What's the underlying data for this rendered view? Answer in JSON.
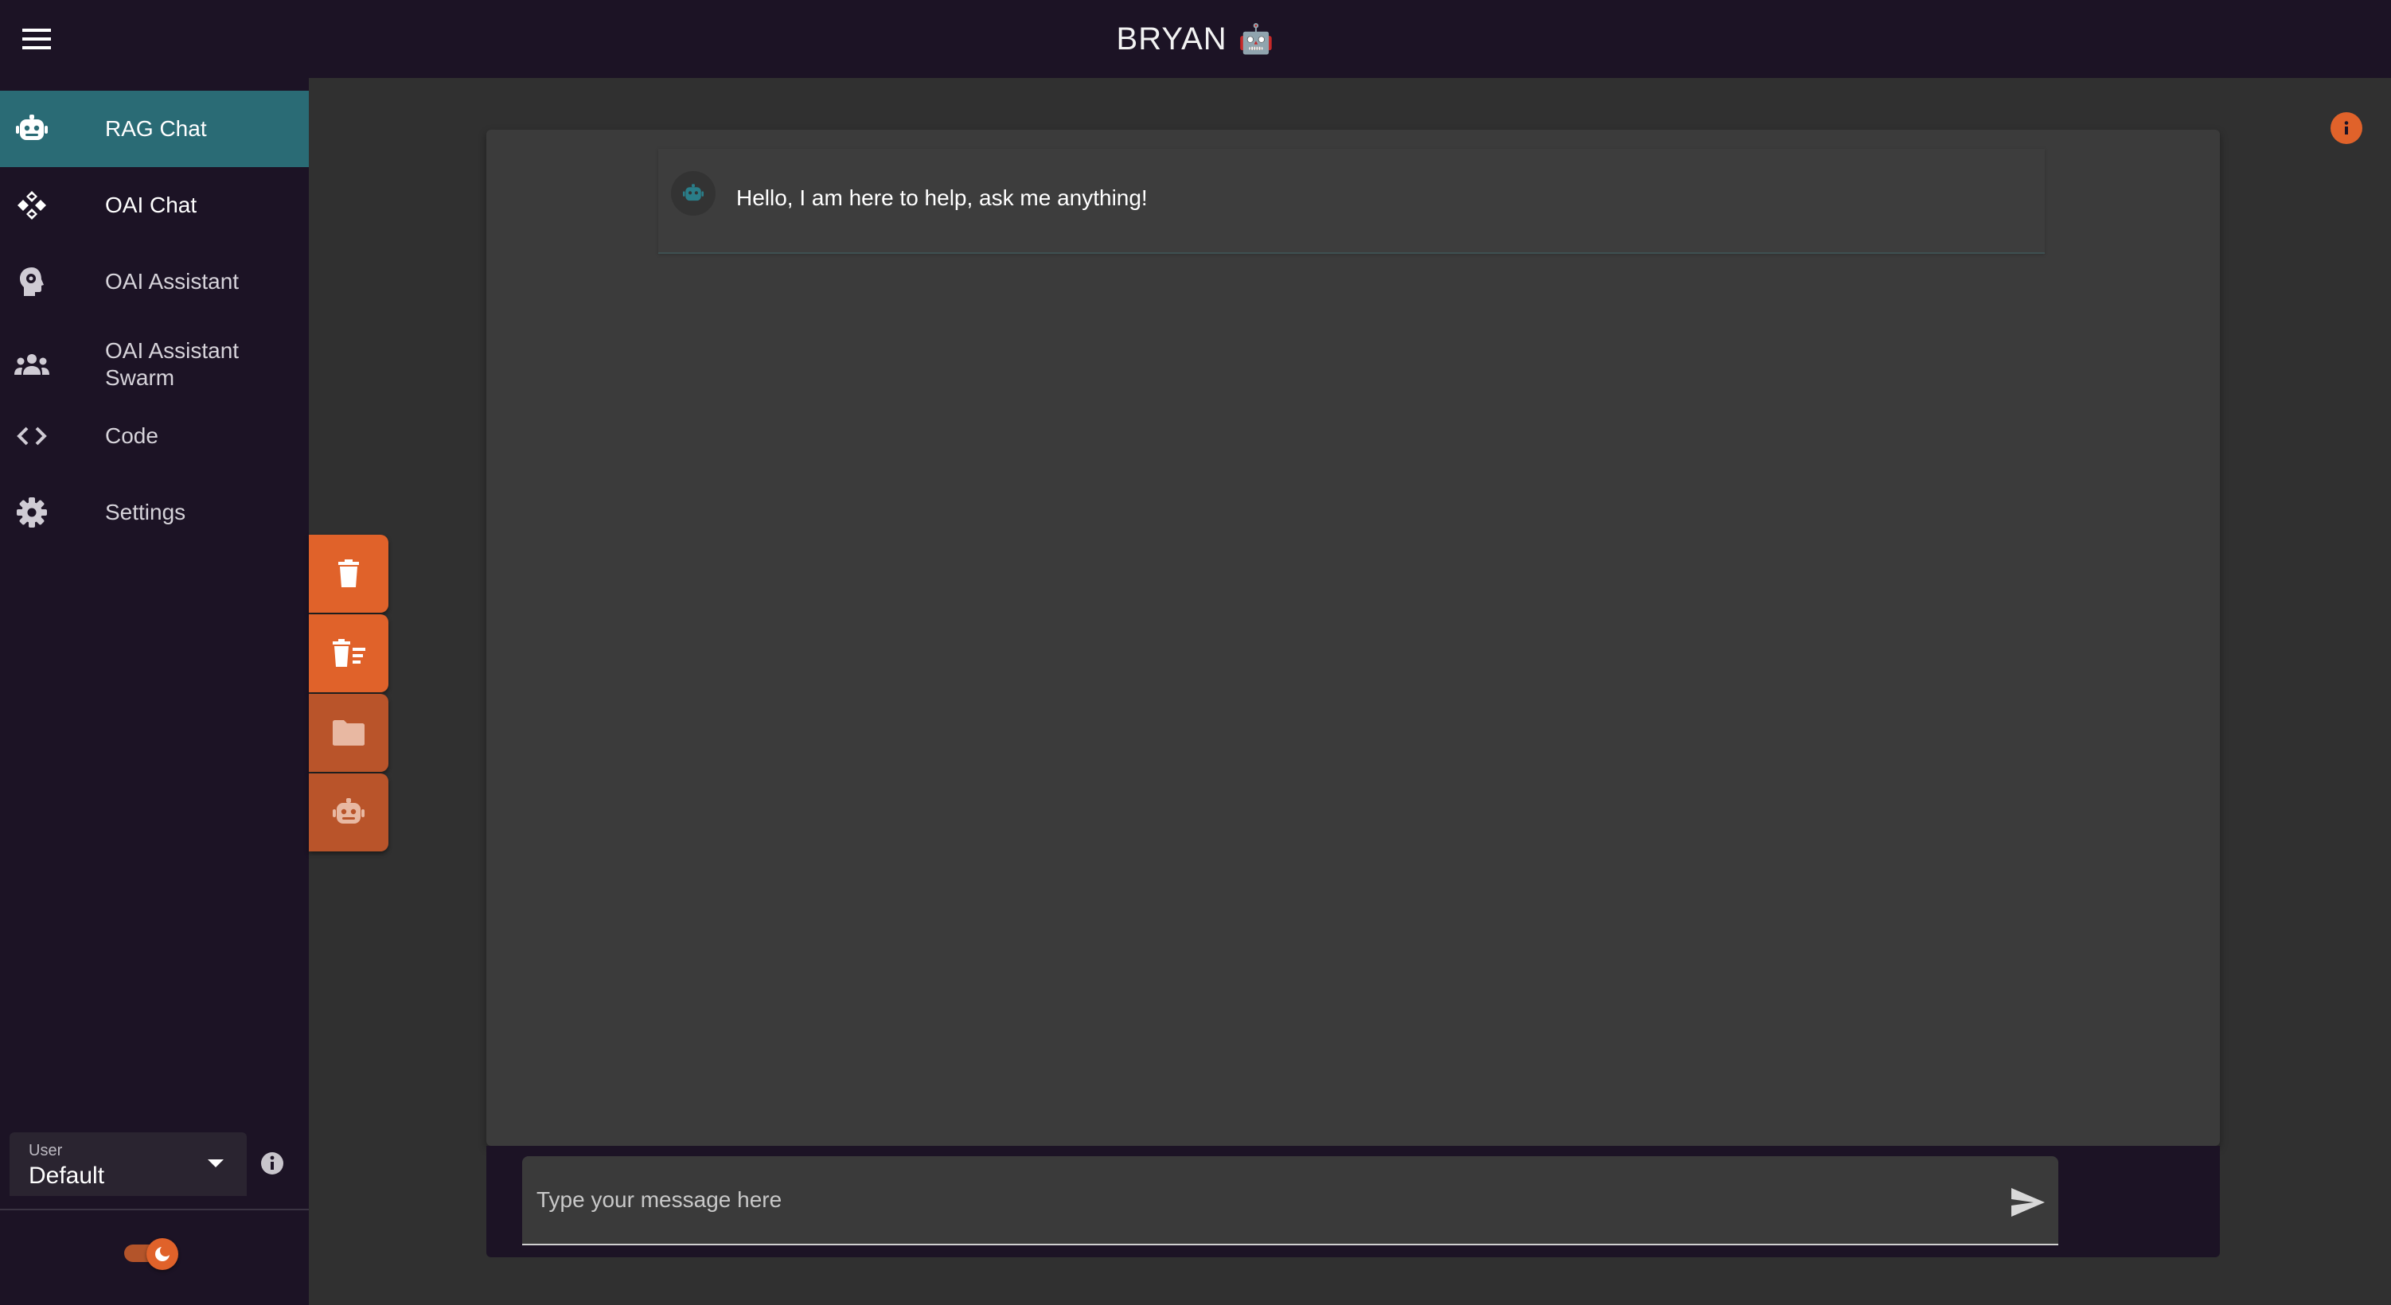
{
  "header": {
    "title": "BRYAN",
    "title_emoji": "🤖",
    "menu_icon": "hamburger-menu-icon"
  },
  "sidebar": {
    "items": [
      {
        "label": "RAG Chat",
        "icon": "robot-icon",
        "active": true
      },
      {
        "label": "OAI Chat",
        "icon": "openai-icon",
        "active": false
      },
      {
        "label": "OAI Assistant",
        "icon": "head-gear-icon",
        "active": false
      },
      {
        "label": "OAI Assistant Swarm",
        "icon": "group-icon",
        "active": false
      },
      {
        "label": "Code",
        "icon": "code-icon",
        "active": false
      },
      {
        "label": "Settings",
        "icon": "gear-icon",
        "active": false
      }
    ],
    "user_select": {
      "label": "User",
      "value": "Default"
    },
    "theme_toggle": {
      "dark_mode": true
    }
  },
  "actions": [
    {
      "name": "delete-chat-button",
      "icon": "trash-icon"
    },
    {
      "name": "delete-history-button",
      "icon": "trash-list-icon"
    },
    {
      "name": "open-folder-button",
      "icon": "folder-icon"
    },
    {
      "name": "bot-settings-button",
      "icon": "robot-icon"
    }
  ],
  "chat": {
    "messages": [
      {
        "role": "assistant",
        "text": "Hello, I am here to help, ask me anything!"
      }
    ],
    "input": {
      "placeholder": "Type your message here",
      "value": ""
    }
  },
  "colors": {
    "accent": "#e0622a",
    "active_nav": "#2a6b75",
    "sidebar_bg": "#1c1325",
    "content_bg": "#303030"
  }
}
